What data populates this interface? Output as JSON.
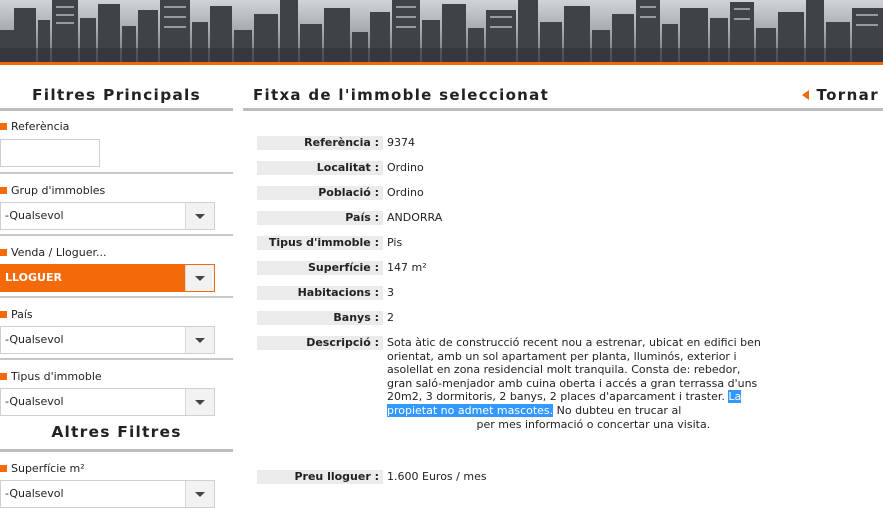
{
  "sidebar": {
    "title": "Filtres Principals",
    "filters": {
      "referencia": {
        "label": "Referència",
        "value": ""
      },
      "grup": {
        "label": "Grup d'immobles",
        "value": "-Qualsevol"
      },
      "venda": {
        "label": "Venda / Lloguer...",
        "value": "LLOGUER"
      },
      "pais": {
        "label": "País",
        "value": "-Qualsevol"
      },
      "tipus": {
        "label": "Tipus d'immoble",
        "value": "-Qualsevol"
      }
    },
    "other_title": "Altres Filtres",
    "superficie": {
      "label": "Superfície m²",
      "value": "-Qualsevol"
    }
  },
  "main": {
    "title": "Fitxa de l'immoble seleccionat",
    "back_label": "Tornar",
    "fields": [
      {
        "label": "Referència :",
        "value": "9374"
      },
      {
        "label": "Localitat :",
        "value": "Ordino"
      },
      {
        "label": "Població :",
        "value": "Ordino"
      },
      {
        "label": "País :",
        "value": "ANDORRA"
      },
      {
        "label": "Tipus d'immoble :",
        "value": "Pis"
      },
      {
        "label": "Superfície :",
        "value": "147 m²"
      },
      {
        "label": "Habitacions :",
        "value": "3"
      },
      {
        "label": "Banys :",
        "value": "2"
      }
    ],
    "description": {
      "label": "Descripció :",
      "text_before": "Sota àtic de construcció recent nou a estrenar, ubicat en edifici ben orientat, amb un sol apartament per planta, lluminós, exterior i asolellat en zona residencial molt tranquila. Consta de: rebedor, gran saló-menjador amb cuina oberta i accés a gran terrassa d'uns 20m2, 3 dormitoris, 2 banys, 2 places d'aparcament i traster.",
      "highlight": "La propietat no admet mascotes.",
      "text_after_1": "No dubteu en trucar al",
      "text_after_2": "per mes informació o concertar una visita."
    },
    "price": {
      "label": "Preu lloguer :",
      "value": "1.600 Euros / mes"
    }
  },
  "colors": {
    "accent": "#f26a0a",
    "highlight": "#3399ff",
    "label_bg": "#ebebeb"
  }
}
